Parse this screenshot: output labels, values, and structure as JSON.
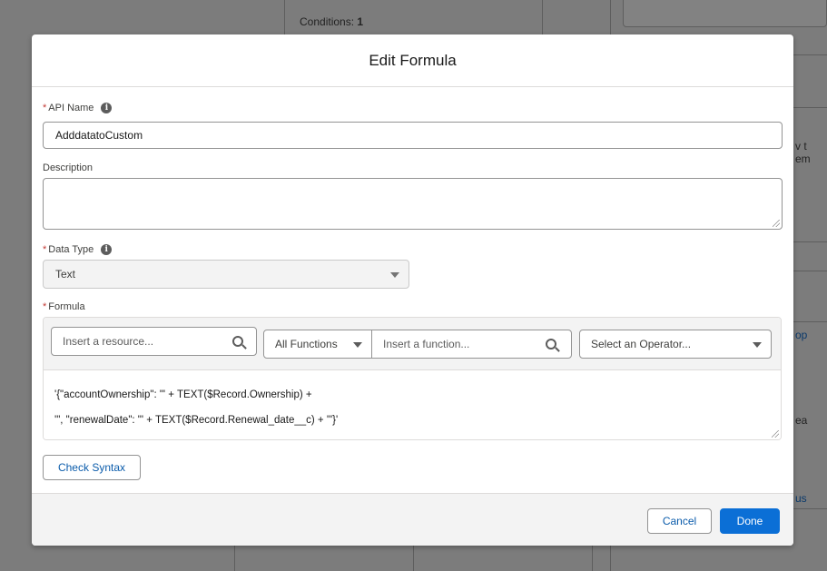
{
  "background": {
    "conditions_label": "Conditions:",
    "conditions_count": "1",
    "frag_1": "v t",
    "frag_2": "em",
    "frag_3": "op",
    "frag_4": "ea",
    "frag_5": "us"
  },
  "modal": {
    "title": "Edit Formula",
    "api_name": {
      "required_mark": "*",
      "label": "API Name",
      "value": "AdddatatoCustom",
      "info_icon": "info-icon"
    },
    "description": {
      "label": "Description",
      "value": ""
    },
    "data_type": {
      "required_mark": "*",
      "label": "Data Type",
      "value": "Text",
      "info_icon": "info-icon"
    },
    "formula": {
      "required_mark": "*",
      "label": "Formula",
      "resource_placeholder": "Insert a resource...",
      "functions_filter": "All Functions",
      "function_placeholder": "Insert a function...",
      "operator_placeholder": "Select an Operator...",
      "lines": [
        "'{\"accountOwnership\": \"' + TEXT($Record.Ownership) +",
        "'\", \"renewalDate\": \"' + TEXT($Record.Renewal_date__c) + '\"}'"
      ]
    },
    "check_syntax_label": "Check Syntax",
    "cancel_label": "Cancel",
    "done_label": "Done"
  },
  "colors": {
    "brand": "#0b6fd6",
    "required": "#c23934",
    "link": "#0b5cab"
  }
}
